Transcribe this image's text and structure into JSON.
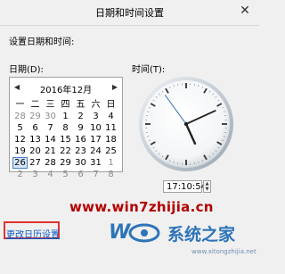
{
  "window": {
    "title": "日期和时间设置",
    "close_icon": "close-icon"
  },
  "main": {
    "heading": "设置日期和时间:",
    "date_label": "日期(D):",
    "time_label": "时间(T):"
  },
  "calendar": {
    "month_label": "2016年12月",
    "prev_icon": "chevron-left-icon",
    "next_icon": "chevron-right-icon",
    "weekdays": [
      "一",
      "二",
      "三",
      "四",
      "五",
      "六",
      "日"
    ],
    "rows": [
      [
        "28",
        "29",
        "30",
        "1",
        "2",
        "3",
        "4"
      ],
      [
        "5",
        "6",
        "7",
        "8",
        "9",
        "10",
        "11"
      ],
      [
        "12",
        "13",
        "14",
        "15",
        "16",
        "17",
        "18"
      ],
      [
        "19",
        "20",
        "21",
        "22",
        "23",
        "24",
        "25"
      ],
      [
        "26",
        "27",
        "28",
        "29",
        "30",
        "31",
        "1"
      ],
      [
        "2",
        "3",
        "4",
        "5",
        "6",
        "7",
        "8"
      ]
    ],
    "selected_day": "26"
  },
  "clock": {
    "hours": 17,
    "minutes": 10,
    "seconds": 54
  },
  "time_input": {
    "value": "17:10:54"
  },
  "footer": {
    "link": "更改日历设置"
  },
  "watermark": {
    "url": "www.win7zhijia.cn",
    "brand": "系统之家",
    "url_small": "www.xitongzhijia.net"
  }
}
